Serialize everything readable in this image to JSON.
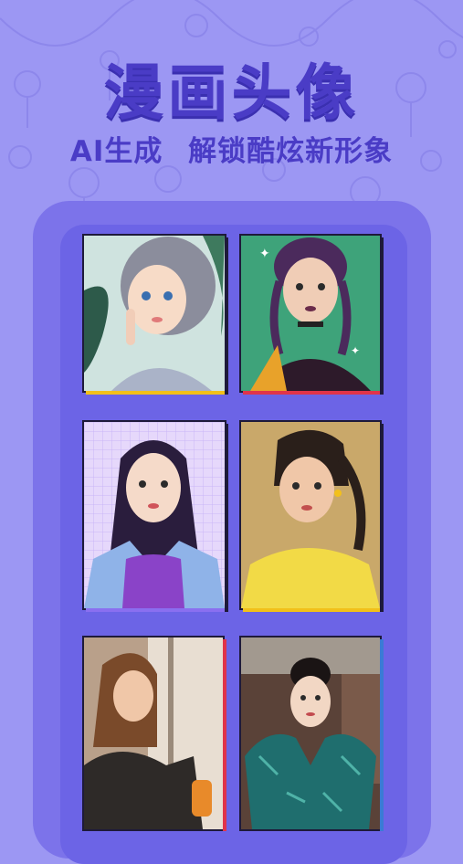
{
  "header": {
    "title": "漫画头像",
    "subtitle_left": "AI生成",
    "subtitle_right": "解锁酷炫新形象"
  },
  "colors": {
    "background": "#9c97f3",
    "accent": "#4a3cc6",
    "phone_frame": "#7c73ea",
    "phone_screen": "#6c64e6",
    "yellow_edge": "#f2c01a",
    "purple_edge": "#8a6ff0",
    "red_edge": "#e0344a"
  },
  "gallery": [
    {
      "name": "avatar-short-hair-girl",
      "icon": "portrait-image"
    },
    {
      "name": "avatar-braided-girl",
      "icon": "portrait-image"
    },
    {
      "name": "avatar-long-hair-woman",
      "icon": "portrait-image"
    },
    {
      "name": "avatar-ponytail-girl",
      "icon": "portrait-image"
    },
    {
      "name": "avatar-window-girl",
      "icon": "portrait-image"
    },
    {
      "name": "avatar-sequin-dress-woman",
      "icon": "portrait-image"
    }
  ]
}
